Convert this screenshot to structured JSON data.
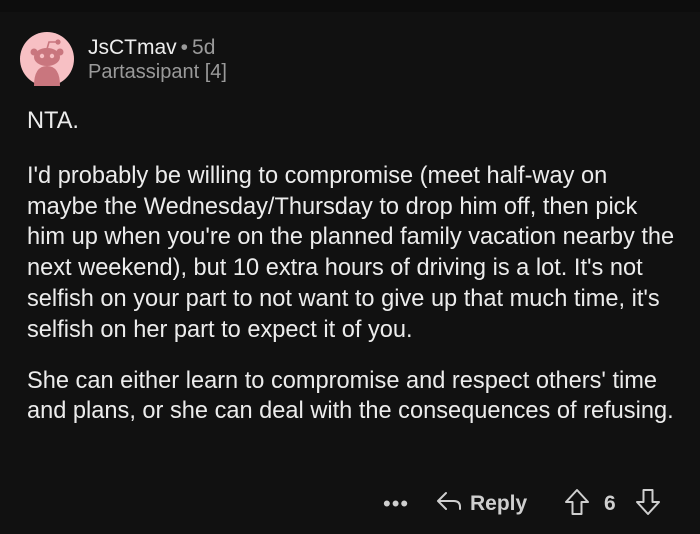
{
  "comment": {
    "author": "JsCTmav",
    "separator": "•",
    "age": "5d",
    "flair": "Partassipant [4]",
    "paragraphs": [
      "NTA.",
      "I'd probably be willing to compromise (meet half-way on maybe the Wednesday/Thursday to drop him off, then pick him up when you're on the planned family vacation nearby the next weekend), but 10 extra hours of driving is a lot. It's not selfish on your part to not want to give up that much time, it's selfish on her part to expect it of you.",
      "She can either learn to compromise and respect others' time and plans, or she can deal with the consequences of refusing."
    ]
  },
  "actions": {
    "more_label": "•••",
    "reply_label": "Reply",
    "score": "6"
  },
  "icons": {
    "avatar": "snoo-avatar-icon",
    "reply": "reply-arrow-icon",
    "upvote": "upvote-arrow-icon",
    "downvote": "downvote-arrow-icon"
  },
  "colors": {
    "background": "#111111",
    "avatar_circle": "#f7c0c4",
    "text": "#ececec",
    "muted": "#9a9a9a"
  }
}
